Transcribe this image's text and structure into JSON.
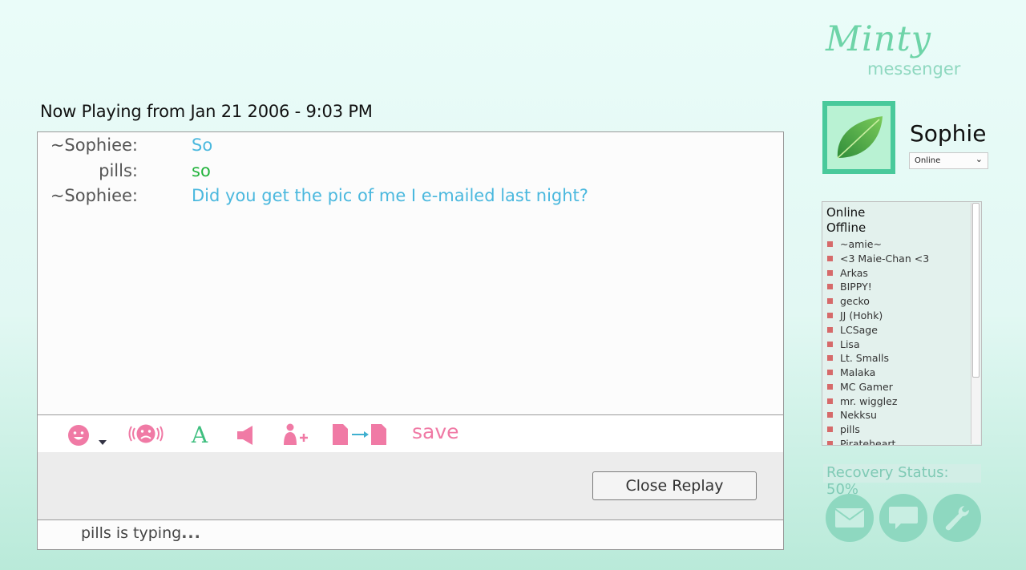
{
  "replay": {
    "header": "Now Playing from Jan 21 2006 - 9:03 PM",
    "messages": [
      {
        "sender": "~Sophiee:",
        "text": "So",
        "color": "#4ab8de"
      },
      {
        "sender": "pills:",
        "text": "so",
        "color": "#22b33c"
      },
      {
        "sender": "~Sophiee:",
        "text": "Did you get the pic of me I e-mailed last night?",
        "color": "#4ab8de"
      }
    ],
    "toolbar": {
      "icons": [
        "smiley-icon",
        "dropdown-arrow-icon",
        "buzz-icon",
        "font-icon",
        "sound-icon",
        "add-contact-icon",
        "file-transfer-icon"
      ],
      "save_label": "save"
    },
    "close_button": "Close Replay",
    "typing_status": "pills is typing",
    "typing_dots": "..."
  },
  "sidebar": {
    "logo_title": "Minty",
    "logo_subtitle": "messenger",
    "user_name": "Sophie",
    "status_value": "Online",
    "avatar_icon": "leaf-icon",
    "groups": [
      "Online",
      "Offline"
    ],
    "offline_contacts": [
      "~amie~",
      "<3 Maie-Chan <3",
      "Arkas",
      "BIPPY!",
      "gecko",
      "JJ (Hohk)",
      "LCSage",
      "Lisa",
      "Lt. Smalls",
      "Malaka",
      "MC Gamer",
      "mr. wigglez",
      "Nekksu",
      "pills",
      "Pirateheart"
    ],
    "recovery_status": "Recovery Status: 50%",
    "buttons": [
      "mail-icon",
      "chat-icon",
      "wrench-icon"
    ]
  },
  "colors": {
    "accent_pink": "#f07aa5",
    "accent_mint": "#8ed8c0",
    "status_offline": "#d66a6a"
  }
}
